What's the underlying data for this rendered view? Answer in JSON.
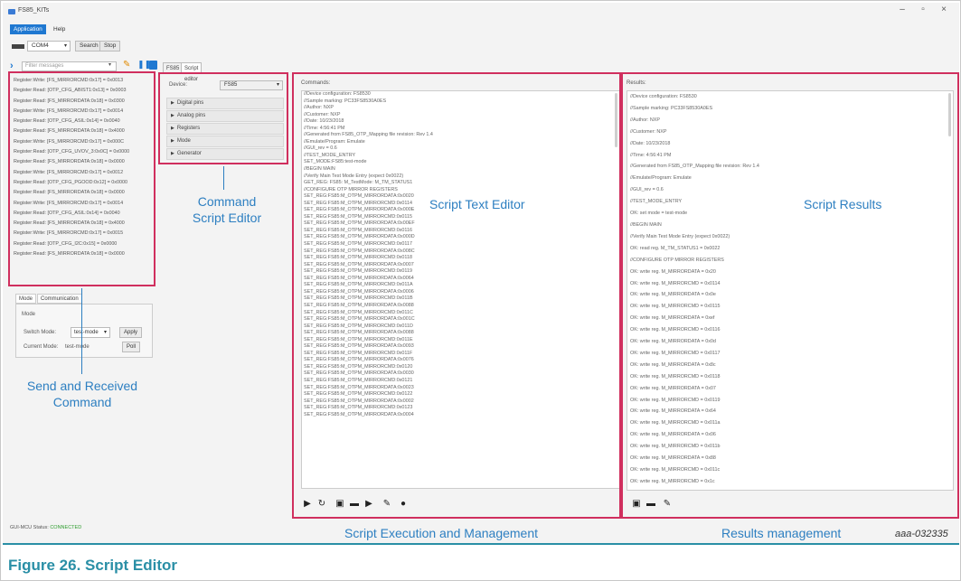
{
  "window": {
    "title": "FS85_KITs",
    "controls": {
      "minimize": "–",
      "maximize": "▫",
      "close": "×"
    }
  },
  "menu": {
    "items": [
      "Application",
      "Help"
    ]
  },
  "toolbar": {
    "port": "COM4",
    "search": "Search",
    "stop": "Stop"
  },
  "filter": {
    "placeholder": "Filter messages"
  },
  "log": {
    "lines": [
      "Register:Write: [FS_MIRRORCMD:0x17] = 0x0013",
      "Register:Read: [OTP_CFG_ABIST1:0x13] = 0x0003",
      "Register:Read: [FS_MIRRORDATA:0x18] = 0x0300",
      "Register:Write: [FS_MIRRORCMD:0x17] = 0x0014",
      "Register:Read: [OTP_CFG_ASIL:0x14] = 0x0040",
      "Register:Read: [FS_MIRRORDATA:0x18] = 0x4000",
      "Register:Write: [FS_MIRRORCMD:0x17] = 0x000C",
      "Register:Read: [OTP_CFG_UVOV_3:0x0C] = 0x0000",
      "Register:Read: [FS_MIRRORDATA:0x18] = 0x0000",
      "Register:Write: [FS_MIRRORCMD:0x17] = 0x0012",
      "Register:Read: [OTP_CFG_PGOOD:0x12] = 0x0000",
      "Register:Read: [FS_MIRRORDATA:0x18] = 0x0000",
      "Register:Write: [FS_MIRRORCMD:0x17] = 0x0014",
      "Register:Read: [OTP_CFG_ASIL:0x14] = 0x0040",
      "Register:Read: [FS_MIRRORDATA:0x18] = 0x4000",
      "Register:Write: [FS_MIRRORCMD:0x17] = 0x0015",
      "Register:Read: [OTP_CFG_I2C:0x15] = 0x0000",
      "Register:Read: [FS_MIRRORDATA:0x18] = 0x0000"
    ]
  },
  "mode_panel": {
    "tabs": [
      "Mode",
      "Communication"
    ],
    "group_label": "Mode",
    "switch_mode_label": "Switch Mode:",
    "switch_mode_value": "test-mode",
    "apply": "Apply",
    "current_mode_label": "Current Mode:",
    "current_mode_value": "test-mode",
    "poll": "Poll"
  },
  "editor_tabs": [
    "FS85",
    "Script editor"
  ],
  "command_editor": {
    "device_label": "Device:",
    "device_value": "FS85",
    "items": [
      "Digital pins",
      "Analog pins",
      "Registers",
      "Mode",
      "Generator"
    ]
  },
  "script": {
    "title": "Commands:",
    "lines": [
      "//Device configuration: FS8530",
      "//Sample marking: PC33FS8530A0ES",
      "//Author: NXP",
      "//Customer: NXP",
      "//Date: 10/23/2018",
      "//Time: 4:56:41 PM",
      "//Generated from FS85_OTP_Mapping file revision: Rev 1.4",
      "//Emulate/Program: Emulate",
      "//GUI_rev = 0.6",
      "//TEST_MODE_ENTRY",
      "SET_MODE:FS85:test-mode",
      "//BEGIN MAIN",
      "//Verify Main Test Mode Entry (expect 0x0022)",
      "GET_REG: FS85: M_TestMode: M_TM_STATUS1",
      "//CONFIGURE OTP MIRROR REGISTERS",
      "SET_REG:FS85:M_OTPM_MIRRORDATA:0x0020",
      "SET_REG:FS85:M_OTPM_MIRRORCMD:0x0114",
      "SET_REG:FS85:M_OTPM_MIRRORDATA:0x000E",
      "SET_REG:FS85:M_OTPM_MIRRORCMD:0x0115",
      "SET_REG:FS85:M_OTPM_MIRRORDATA:0x00EF",
      "SET_REG:FS85:M_OTPM_MIRRORCMD:0x0116",
      "SET_REG:FS85:M_OTPM_MIRRORDATA:0x000D",
      "SET_REG:FS85:M_OTPM_MIRRORCMD:0x0117",
      "SET_REG:FS85:M_OTPM_MIRRORDATA:0x008C",
      "SET_REG:FS85:M_OTPM_MIRRORCMD:0x0118",
      "SET_REG:FS85:M_OTPM_MIRRORDATA:0x0007",
      "SET_REG:FS85:M_OTPM_MIRRORCMD:0x0119",
      "SET_REG:FS85:M_OTPM_MIRRORDATA:0x0064",
      "SET_REG:FS85:M_OTPM_MIRRORCMD:0x011A",
      "SET_REG:FS85:M_OTPM_MIRRORDATA:0x0006",
      "SET_REG:FS85:M_OTPM_MIRRORCMD:0x011B",
      "SET_REG:FS85:M_OTPM_MIRRORDATA:0x0088",
      "SET_REG:FS85:M_OTPM_MIRRORCMD:0x011C",
      "SET_REG:FS85:M_OTPM_MIRRORDATA:0x001C",
      "SET_REG:FS85:M_OTPM_MIRRORCMD:0x011D",
      "SET_REG:FS85:M_OTPM_MIRRORDATA:0x0088",
      "SET_REG:FS85:M_OTPM_MIRRORCMD:0x011E",
      "SET_REG:FS85:M_OTPM_MIRRORDATA:0x0093",
      "SET_REG:FS85:M_OTPM_MIRRORCMD:0x011F",
      "SET_REG:FS85:M_OTPM_MIRRORDATA:0x0076",
      "SET_REG:FS85:M_OTPM_MIRRORCMD:0x0120",
      "SET_REG:FS85:M_OTPM_MIRRORDATA:0x0030",
      "SET_REG:FS85:M_OTPM_MIRRORCMD:0x0121",
      "SET_REG:FS85:M_OTPM_MIRRORDATA:0x0023",
      "SET_REG:FS85:M_OTPM_MIRRORCMD:0x0122",
      "SET_REG:FS85:M_OTPM_MIRRORDATA:0x0002",
      "SET_REG:FS85:M_OTPM_MIRRORCMD:0x0123",
      "SET_REG:FS85:M_OTPM_MIRRORDATA:0x0004"
    ]
  },
  "results": {
    "title": "Results:",
    "lines": [
      "//Device configuration: FS8530",
      "//Sample marking: PC33FS8530A0ES",
      "//Author: NXP",
      "//Customer: NXP",
      "//Date: 10/23/2018",
      "//Time: 4:56:41 PM",
      "//Generated from FS85_OTP_Mapping file revision: Rev 1.4",
      "//Emulate/Program: Emulate",
      "//GUI_rev = 0.6",
      "//TEST_MODE_ENTRY",
      "OK: set mode = test-mode",
      "//BEGIN MAIN",
      "//Verify Main Test Mode Entry (expect 0x0022)",
      "OK: read reg. M_TM_STATUS1 = 0x0022",
      "//CONFIGURE OTP MIRROR REGISTERS",
      "OK: write reg. M_MIRRORDATA = 0x20",
      "OK: write reg. M_MIRRORCMD = 0x0114",
      "OK: write reg. M_MIRRORDATA = 0x0e",
      "OK: write reg. M_MIRRORCMD = 0x0115",
      "OK: write reg. M_MIRRORDATA = 0xef",
      "OK: write reg. M_MIRRORCMD = 0x0116",
      "OK: write reg. M_MIRRORDATA = 0x0d",
      "OK: write reg. M_MIRRORCMD = 0x0117",
      "OK: write reg. M_MIRRORDATA = 0x8c",
      "OK: write reg. M_MIRRORCMD = 0x0118",
      "OK: write reg. M_MIRRORDATA = 0x07",
      "OK: write reg. M_MIRRORCMD = 0x0119",
      "OK: write reg. M_MIRRORDATA = 0x64",
      "OK: write reg. M_MIRRORCMD = 0x011a",
      "OK: write reg. M_MIRRORDATA = 0x06",
      "OK: write reg. M_MIRRORCMD = 0x011b",
      "OK: write reg. M_MIRRORDATA = 0x88",
      "OK: write reg. M_MIRRORCMD = 0x011c",
      "OK: write reg. M_MIRRORCMD = 0x1c"
    ]
  },
  "status": {
    "label": "GUI-MCU Status:",
    "value": "CONNECTED"
  },
  "annotations": {
    "command_script_editor": [
      "Command",
      "Script Editor"
    ],
    "script_text_editor": "Script Text Editor",
    "script_results": "Script Results",
    "send_received": [
      "Send and Received",
      "Command"
    ],
    "script_execution": "Script Execution and Management",
    "results_management": "Results management"
  },
  "figure": {
    "code": "aaa-032335",
    "caption": "Figure 26.  Script Editor"
  },
  "colors": {
    "accent": "#1f78d1",
    "annotation_box": "#d02f5e",
    "annotation_text": "#2d7fc1",
    "caption": "#2a8fa6",
    "status_ok": "#2e9d2e"
  },
  "icons": {
    "execution": [
      "play-icon",
      "refresh-icon",
      "save-icon",
      "open-folder-icon",
      "export-icon",
      "clear-icon",
      "help-icon"
    ],
    "results": [
      "save-icon",
      "open-folder-icon",
      "clear-icon"
    ]
  }
}
